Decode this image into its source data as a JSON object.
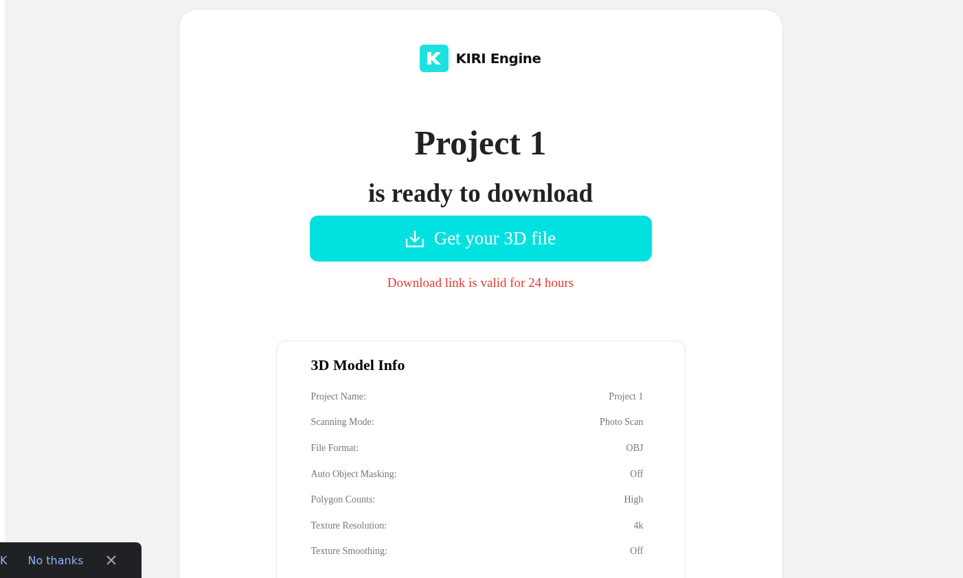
{
  "brand": {
    "name": "KIRI Engine"
  },
  "title": "Project 1",
  "subtitle": "is ready to download",
  "download_button": {
    "label": "Get your 3D file"
  },
  "validity_note": "Download link is valid for 24 hours",
  "model_info": {
    "heading": "3D Model Info",
    "rows": [
      {
        "label": "Project Name:",
        "value": "Project 1"
      },
      {
        "label": "Scanning Mode:",
        "value": "Photo Scan"
      },
      {
        "label": "File Format:",
        "value": "OBJ"
      },
      {
        "label": "Auto Object Masking:",
        "value": "Off"
      },
      {
        "label": "Polygon Counts:",
        "value": "High"
      },
      {
        "label": "Texture Resolution:",
        "value": "4k"
      },
      {
        "label": "Texture Smoothing:",
        "value": "Off"
      }
    ]
  },
  "snackbar": {
    "actions": [
      "K",
      "No thanks"
    ]
  }
}
